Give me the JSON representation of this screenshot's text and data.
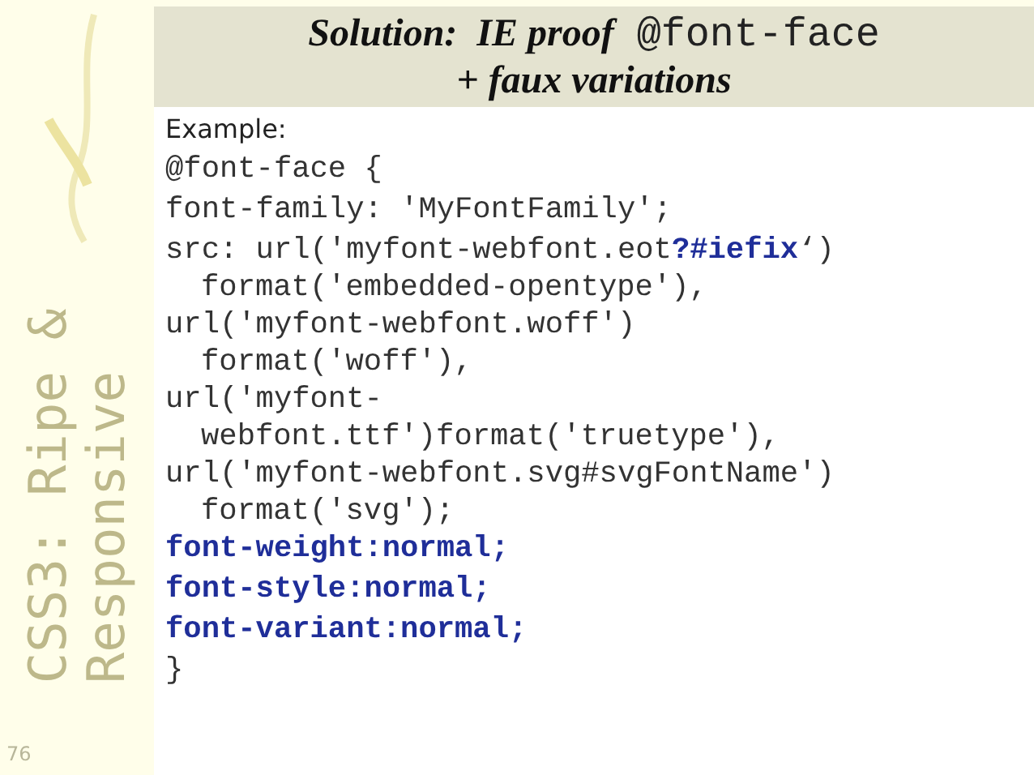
{
  "sidebar": {
    "deck_title": [
      "CSS3: Ripe &",
      "Responsive"
    ],
    "slide_number": "76"
  },
  "title": {
    "text": "Solution:  IE proof",
    "code": "@font-face",
    "subtitle": "+ faux variations"
  },
  "intro": "Example:",
  "code_lines": [
    {
      "kind": "plain",
      "text": "@font-face {"
    },
    {
      "kind": "plain",
      "text": "font-family: 'MyFontFamily';"
    },
    {
      "kind": "plain",
      "text": "src: url('myfont-webfont.eot**?#iefix**‘)"
    },
    {
      "kind": "indent",
      "text": "format('embedded-opentype'),"
    },
    {
      "kind": "plain",
      "text": "url('myfont-webfont.woff')"
    },
    {
      "kind": "indent",
      "text": "format('woff'),"
    },
    {
      "kind": "plain",
      "text": "url('myfont-"
    },
    {
      "kind": "indent",
      "text": "webfont.ttf')format('truetype'),"
    },
    {
      "kind": "plain",
      "text": "url('myfont-webfont.svg#svgFontName')"
    },
    {
      "kind": "indent",
      "text": "format('svg');"
    },
    {
      "kind": "emphasis",
      "text": "font-weight:normal;"
    },
    {
      "kind": "emphasis",
      "text": "font-style:normal;"
    },
    {
      "kind": "emphasis",
      "text": "font-variant:normal;"
    },
    {
      "kind": "plain",
      "text": "}"
    }
  ]
}
